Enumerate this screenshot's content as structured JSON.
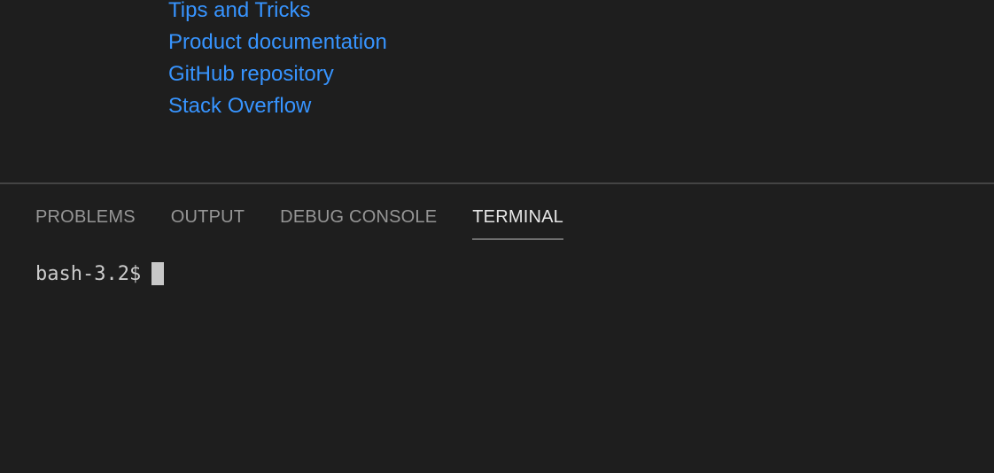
{
  "editor": {
    "help_links": [
      {
        "label": "Tips and Tricks"
      },
      {
        "label": "Product documentation"
      },
      {
        "label": "GitHub repository"
      },
      {
        "label": "Stack Overflow"
      }
    ]
  },
  "panel": {
    "tabs": [
      {
        "label": "PROBLEMS",
        "active": false
      },
      {
        "label": "OUTPUT",
        "active": false
      },
      {
        "label": "DEBUG CONSOLE",
        "active": false
      },
      {
        "label": "TERMINAL",
        "active": true
      }
    ],
    "terminal": {
      "prompt": "bash-3.2$"
    }
  },
  "colors": {
    "background": "#1e1e1e",
    "link": "#3794ff",
    "tab_inactive": "#969696",
    "tab_active": "#e7e7e7",
    "terminal_text": "#cccccc"
  }
}
